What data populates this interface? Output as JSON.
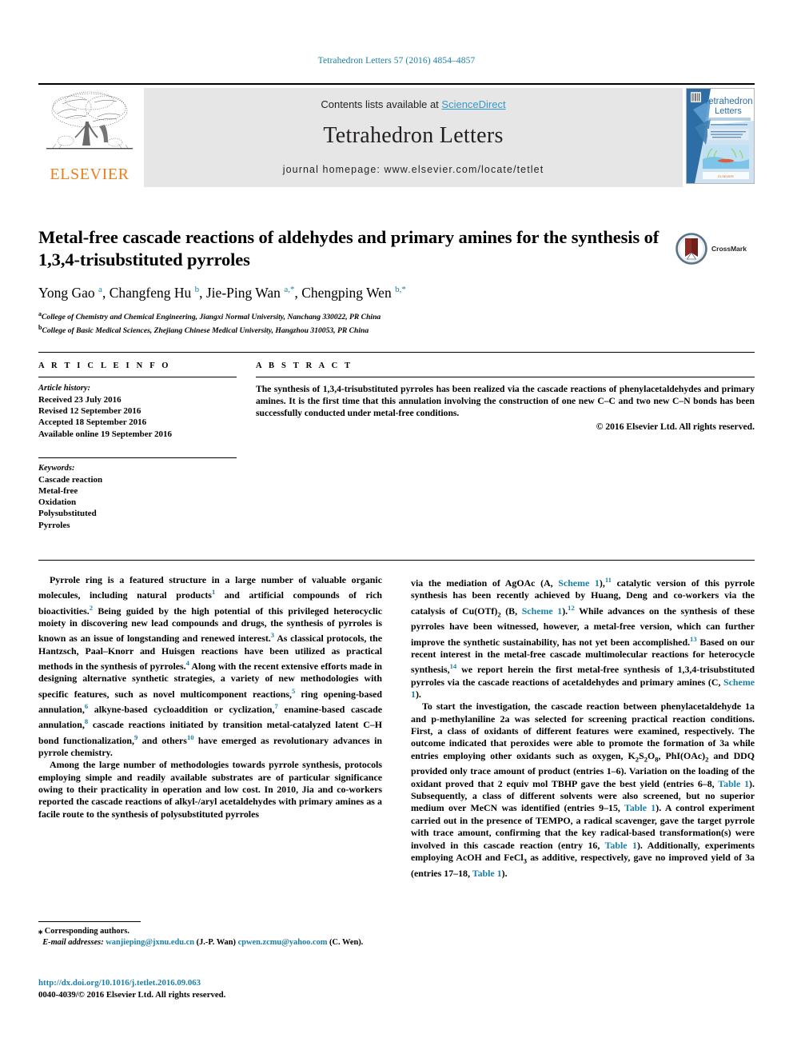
{
  "running_head": "Tetrahedron Letters 57 (2016) 4854–4857",
  "masthead": {
    "contents_prefix": "Contents lists available at ",
    "sciencedirect": "ScienceDirect",
    "journal_title": "Tetrahedron Letters",
    "homepage": "journal homepage: www.elsevier.com/locate/tetlet",
    "publisher_wordmark": "ELSEVIER",
    "publisher_color": "#f07d18",
    "cover_title_line1": "Tetrahedron",
    "cover_title_line2": "Letters",
    "link_color": "#3399cc",
    "band_color": "#e6e6e6"
  },
  "article": {
    "title": "Metal-free cascade reactions of aldehydes and primary amines for the synthesis of 1,3,4-trisubstituted pyrroles",
    "authors_html": "Yong Gao <sup class=\"aff-mark\">a</sup>, Changfeng Hu <sup class=\"aff-mark\">b</sup>, Jie-Ping Wan <sup class=\"aff-mark\">a,*</sup>, Chengping Wen <sup class=\"aff-mark\">b,*</sup>",
    "affiliation_a": "College of Chemistry and Chemical Engineering, Jiangxi Normal University, Nanchang 330022, PR China",
    "affiliation_b": "College of Basic Medical Sciences, Zhejiang Chinese Medical University, Hangzhou 310053, PR China",
    "crossmark_label": "CrossMark",
    "crossmark_color": "#8c2a26"
  },
  "article_info": {
    "heading": "A R T I C L E   I N F O",
    "history_label": "Article history:",
    "history": [
      "Received 23 July 2016",
      "Revised 12 September 2016",
      "Accepted 18 September 2016",
      "Available online 19 September 2016"
    ],
    "keywords_label": "Keywords:",
    "keywords": [
      "Cascade reaction",
      "Metal-free",
      "Oxidation",
      "Polysubstituted",
      "Pyrroles"
    ]
  },
  "abstract": {
    "heading": "A B S T R A C T",
    "text": "The synthesis of 1,3,4-trisubstituted pyrroles has been realized via the cascade reactions of phenylacetaldehydes and primary amines. It is the first time that this annulation involving the construction of one new C–C and two new C–N bonds has been successfully conducted under metal-free conditions.",
    "copyright": "© 2016 Elsevier Ltd. All rights reserved."
  },
  "body": {
    "left_p1_html": "Pyrrole ring is a featured structure in a large number of valuable organic molecules, including natural products<sup class=\"ref\">1</sup> and artificial compounds of rich bioactivities.<sup class=\"ref\">2</sup> Being guided by the high potential of this privileged heterocyclic moiety in discovering new lead compounds and drugs, the synthesis of pyrroles is known as an issue of longstanding and renewed interest.<sup class=\"ref\">3</sup> As classical protocols, the Hantzsch, Paal–Knorr and Huisgen reactions have been utilized as practical methods in the synthesis of pyrroles.<sup class=\"ref\">4</sup> Along with the recent extensive efforts made in designing alternative synthetic strategies, a variety of new methodologies with specific features, such as novel multicomponent reactions,<sup class=\"ref\">5</sup> ring opening-based annulation,<sup class=\"ref\">6</sup> alkyne-based cycloaddition or cyclization,<sup class=\"ref\">7</sup> enamine-based cascade annulation,<sup class=\"ref\">8</sup> cascade reactions initiated by transition metal-catalyzed latent C–H bond functionalization,<sup class=\"ref\">9</sup> and others<sup class=\"ref\">10</sup> have emerged as revolutionary advances in pyrrole chemistry.",
    "left_p2_html": "Among the large number of methodologies towards pyrrole synthesis, protocols employing simple and readily available substrates are of particular significance owing to their practicality in operation and low cost. In 2010, Jia and co-workers reported the cascade reactions of alkyl-/aryl acetaldehydes with primary amines as a facile route to the synthesis of polysubstituted pyrroles",
    "right_p1_html": "via the mediation of AgOAc (A, <a class=\"xref\" href=\"#\">Scheme 1</a>),<sup class=\"ref\">11</sup> catalytic version of this pyrrole synthesis has been recently achieved by Huang, Deng and co-workers via the catalysis of Cu(OTf)<sub>2</sub> (B, <a class=\"xref\" href=\"#\">Scheme 1</a>).<sup class=\"ref\">12</sup> While advances on the synthesis of these pyrroles have been witnessed, however, a metal-free version, which can further improve the synthetic sustainability, has not yet been accomplished.<sup class=\"ref\">13</sup> Based on our recent interest in the metal-free cascade multimolecular reactions for heterocycle synthesis,<sup class=\"ref\">14</sup> we report herein the first metal-free synthesis of 1,3,4-trisubstituted pyrroles via the cascade reactions of acetaldehydes and primary amines (C, <a class=\"xref\" href=\"#\">Scheme 1</a>).",
    "right_p2_html": "To start the investigation, the cascade reaction between phenylacetaldehyde <b>1a</b> and p-methylaniline <b>2a</b> was selected for screening practical reaction conditions. First, a class of oxidants of different features were examined, respectively. The outcome indicated that peroxides were able to promote the formation of <b>3a</b> while entries employing other oxidants such as oxygen, K<sub>2</sub>S<sub>2</sub>O<sub>8</sub>, PhI(OAc)<sub>2</sub> and DDQ provided only trace amount of product (entries 1–6). Variation on the loading of the oxidant proved that 2 equiv mol TBHP gave the best yield (entries 6–8, <a class=\"xref\" href=\"#\">Table 1</a>). Subsequently, a class of different solvents were also screened, but no superior medium over MeCN was identified (entries 9–15, <a class=\"xref\" href=\"#\">Table 1</a>). A control experiment carried out in the presence of TEMPO, a radical scavenger, gave the target pyrrole with trace amount, confirming that the key radical-based transformation(s) were involved in this cascade reaction (entry 16, <a class=\"xref\" href=\"#\">Table 1</a>). Additionally, experiments employing AcOH and FeCl<sub>3</sub> as additive, respectively, gave no improved yield of <b>3a</b> (entries 17–18, <a class=\"xref\" href=\"#\">Table 1</a>)."
  },
  "footer": {
    "corresponding": "⁎ Corresponding authors.",
    "email_label": "E-mail addresses:",
    "email_1": "wanjieping@jxnu.edu.cn",
    "email_1_owner": "(J.-P. Wan)",
    "email_2": "cpwen.zcmu@yahoo.com",
    "email_2_owner": "(C. Wen).",
    "doi": "http://dx.doi.org/10.1016/j.tetlet.2016.09.063",
    "issn_line": "0040-4039/© 2016 Elsevier Ltd. All rights reserved."
  }
}
